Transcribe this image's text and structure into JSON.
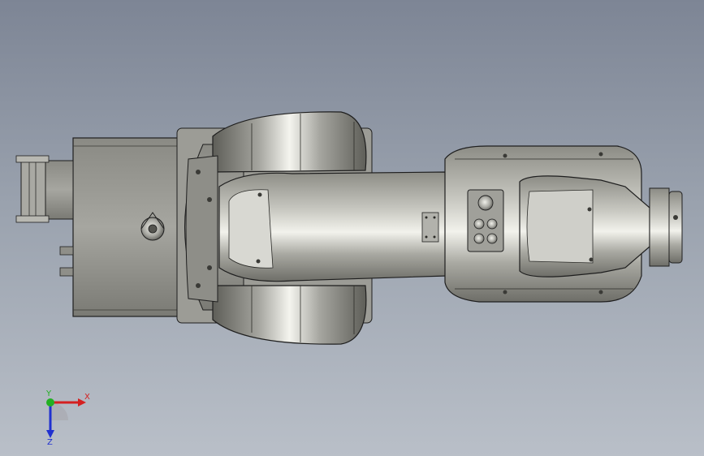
{
  "viewport": {
    "background_top": "#7d8595",
    "background_bottom": "#b9bfc8"
  },
  "model": {
    "body_color": "#9a9a92",
    "highlight_color": "#e8e8e2",
    "edge_color": "#1e1e1e"
  },
  "triad": {
    "x_label": "X",
    "y_label": "Y",
    "z_label": "Z",
    "x_color": "#d42020",
    "y_color": "#22b022",
    "z_color": "#2030d0"
  }
}
